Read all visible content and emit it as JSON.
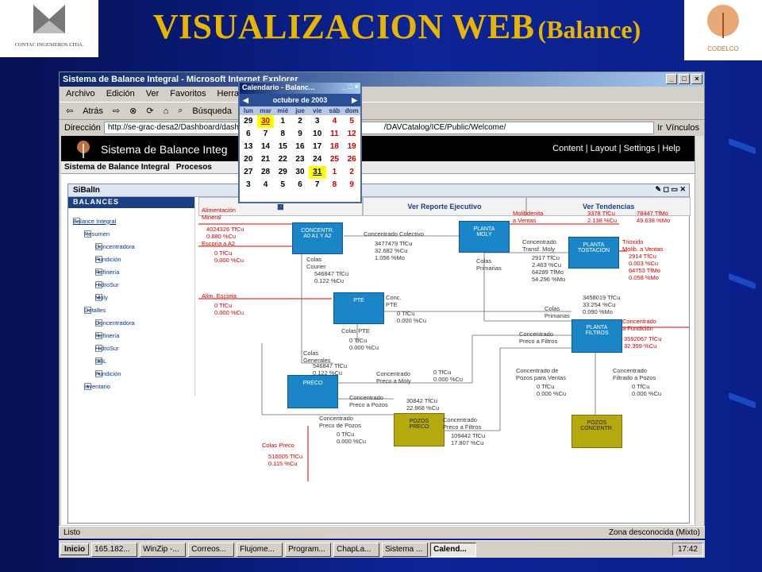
{
  "slide": {
    "title_main": "VISUALIZACION WEB",
    "title_sub": "(Balance)",
    "logo_left_text": "CONTAC INGENIEROS LTDA.",
    "logo_right_text": "CODELCO"
  },
  "browser": {
    "title": "Sistema de Balance Integral - Microsoft Internet Explorer",
    "menu": [
      "Archivo",
      "Edición",
      "Ver",
      "Favoritos",
      "Herramientas"
    ],
    "toolbar": {
      "back": "Atrás",
      "search": "Búsqueda"
    },
    "address_label": "Dirección",
    "address_value": "http://se-grac-desa2/Dashboard/dashboar",
    "address_tail": "/DAVCatalog/ICE/Public/Welcome/",
    "go": "Ir",
    "links": "Vínculos"
  },
  "app": {
    "title": "Sistema de Balance Integ",
    "nav": "Content | Layout | Settings | Help",
    "tabs": [
      "Sistema de Balance Integral",
      "Procesos"
    ],
    "portlet_title": "SiBalIn",
    "side_header": "BALANCES",
    "tree": [
      {
        "label": "Balance Integral",
        "level": 0,
        "pm": "−",
        "root": true
      },
      {
        "label": "Resumen",
        "level": 1,
        "pm": "−"
      },
      {
        "label": "Concentradora",
        "level": 2,
        "pm": "+"
      },
      {
        "label": "Fundición",
        "level": 2,
        "pm": "+"
      },
      {
        "label": "Refinería",
        "level": 2,
        "pm": "+"
      },
      {
        "label": "HidroSur",
        "level": 2,
        "pm": "+"
      },
      {
        "label": "Moly",
        "level": 2,
        "pm": "+"
      },
      {
        "label": "Detalles",
        "level": 1,
        "pm": "−"
      },
      {
        "label": "Concentradora",
        "level": 2,
        "pm": "+"
      },
      {
        "label": "Refinería",
        "level": 2,
        "pm": "+"
      },
      {
        "label": "HidroSur",
        "level": 2,
        "pm": "+"
      },
      {
        "label": "SBL",
        "level": 2,
        "pm": "+"
      },
      {
        "label": "Fundición",
        "level": 2,
        "pm": "+"
      },
      {
        "label": "Inventario",
        "level": 1,
        "pm": "+"
      }
    ],
    "tab_buttons": [
      "",
      "Ver Reporte Ejecutivo",
      "Ver Tendencias"
    ]
  },
  "calendar": {
    "title": "Calendario - Balanc...",
    "month": "octubre de 2003",
    "dow": [
      "lun",
      "mar",
      "mié",
      "jue",
      "vie",
      "sáb",
      "dom"
    ],
    "weeks": [
      [
        "29",
        "30",
        "1",
        "2",
        "3",
        "4",
        "5"
      ],
      [
        "6",
        "7",
        "8",
        "9",
        "10",
        "11",
        "12"
      ],
      [
        "13",
        "14",
        "15",
        "16",
        "17",
        "18",
        "19"
      ],
      [
        "20",
        "21",
        "22",
        "23",
        "24",
        "25",
        "26"
      ],
      [
        "27",
        "28",
        "29",
        "30",
        "31",
        "1",
        "2"
      ],
      [
        "3",
        "4",
        "5",
        "6",
        "7",
        "8",
        "9"
      ]
    ]
  },
  "diagram": {
    "boxes": {
      "concentr": "CONCENTR.\nA0 A1 Y A2",
      "planta_moly": "PLANTA\nMOLY",
      "planta_tostacion": "PLANTA\nTOSTACION",
      "pte": "PTE",
      "planta_filtros": "PLANTA\nFILTROS",
      "preco": "PRECO",
      "pozos_preco": "POZOS\nPRECO",
      "pozos_concentr": "POZOS\nCONCENTR."
    },
    "labels": {
      "alim_mineral": "Alimentación\nMineral",
      "alim_mineral_v": "4024326  TfCu\n   0.880  %Cu",
      "escoria_a2": "Escoria a A2",
      "escoria_a2_v": "       0  TfCu\n0.000  %Cu",
      "alim_escoria": "Alim. Escoria",
      "alim_escoria_v": "       0  TfCu\n0.000  %Cu",
      "conc_colectivo": "Concentrado Colectivo",
      "conc_colectivo_v": "3477479  TfCu\n  32.682  %Cu\n   1.056  %Mo",
      "colas_courier": "Colas\nCourier",
      "colas_courier_v": "546847  TfCu\n  0.122  %Cu",
      "molibdenita": "Molibdenita\na Ventas",
      "molibdenita_v": "3378  TfCu\n2.138  %Cu",
      "molibdenita_v2": "78447  TfMo\n49.638  %Mo",
      "conc_transf_moly": "Concentrado\nTransf. Moly",
      "conc_transf_moly_v": "2917  TfCu\n2.463  %Cu\n64299  TfMo\n54.296  %Mo",
      "colas_primarias1": "Colas\nPrimarias",
      "trioxido": "Trioxido\nMolib. a Ventas",
      "trioxido_v": "2914  TfCu\n0.003  %Cu\n64753  TfMo\n0.058  %Mo",
      "colas_primarias2": "Colas\nPrimarias",
      "colas_primarias2_v": "3458019  TfCu\n 33.254  %Cu\n  0.090  %Mo",
      "conc_pte": "Conc.\nPTE",
      "conc_pte_v": "       0  TfCu\n0.000  %Cu",
      "colas_pte": "Colas PTE",
      "colas_pte_v": "       0  TfCu\n0.000  %Cu",
      "conc_fundicion": "Concentrado\na Fundición",
      "conc_fundicion_v": "3592067  TfCu\n 32.399  %Cu",
      "conc_filtros": "Concentrado\nPreco a Filtros",
      "colas_generales": "Colas\nGenerales",
      "colas_generales_v": "546847  TfCu\n  0.122  %Cu",
      "conc_preco_moly": "Concentrado\nPreco a Moly",
      "conc_preco_moly_v": "       0  TfCu\n0.000  %Cu",
      "conc_preco_pozos": "Concentrado\nPreco a Pozos",
      "conc_preco_pozos_v": "30842  TfCu\n22.968  %Cu",
      "conc_pozos_ventas": "Concentrado de\nPozos para Ventas",
      "conc_pozos_ventas_v": "       0  TfCu\n0.000  %Cu",
      "conc_filtrado_pozos": "Concentrado\nFiltrado a Pozos",
      "conc_filtrado_pozos_v": "       0  TfCu\n0.000  %Cu",
      "conc_preco_pozos2": "Concentrado\nPreco de Pozos",
      "conc_preco_pozos2_v": "       0  TfCu\n0.000  %Cu",
      "conc_preco_filtros": "Concentrado\nPreco a Filtros",
      "conc_preco_filtros_v": "109442  TfCu\n17.807  %Cu",
      "colas_preco": "Colas Preco",
      "colas_preco_v": "516005  TfCu\n  0.115  %Cu"
    }
  },
  "status": {
    "left": "Listo",
    "right": "Zona desconocida (Mixto)"
  },
  "taskbar": {
    "start": "Inicio",
    "tasks": [
      "165.182...",
      "WinZip -...",
      "Correos...",
      "Flujome...",
      "Program...",
      "ChapLa...",
      "Sistema ...",
      "Calend..."
    ],
    "clock": "17:42"
  }
}
